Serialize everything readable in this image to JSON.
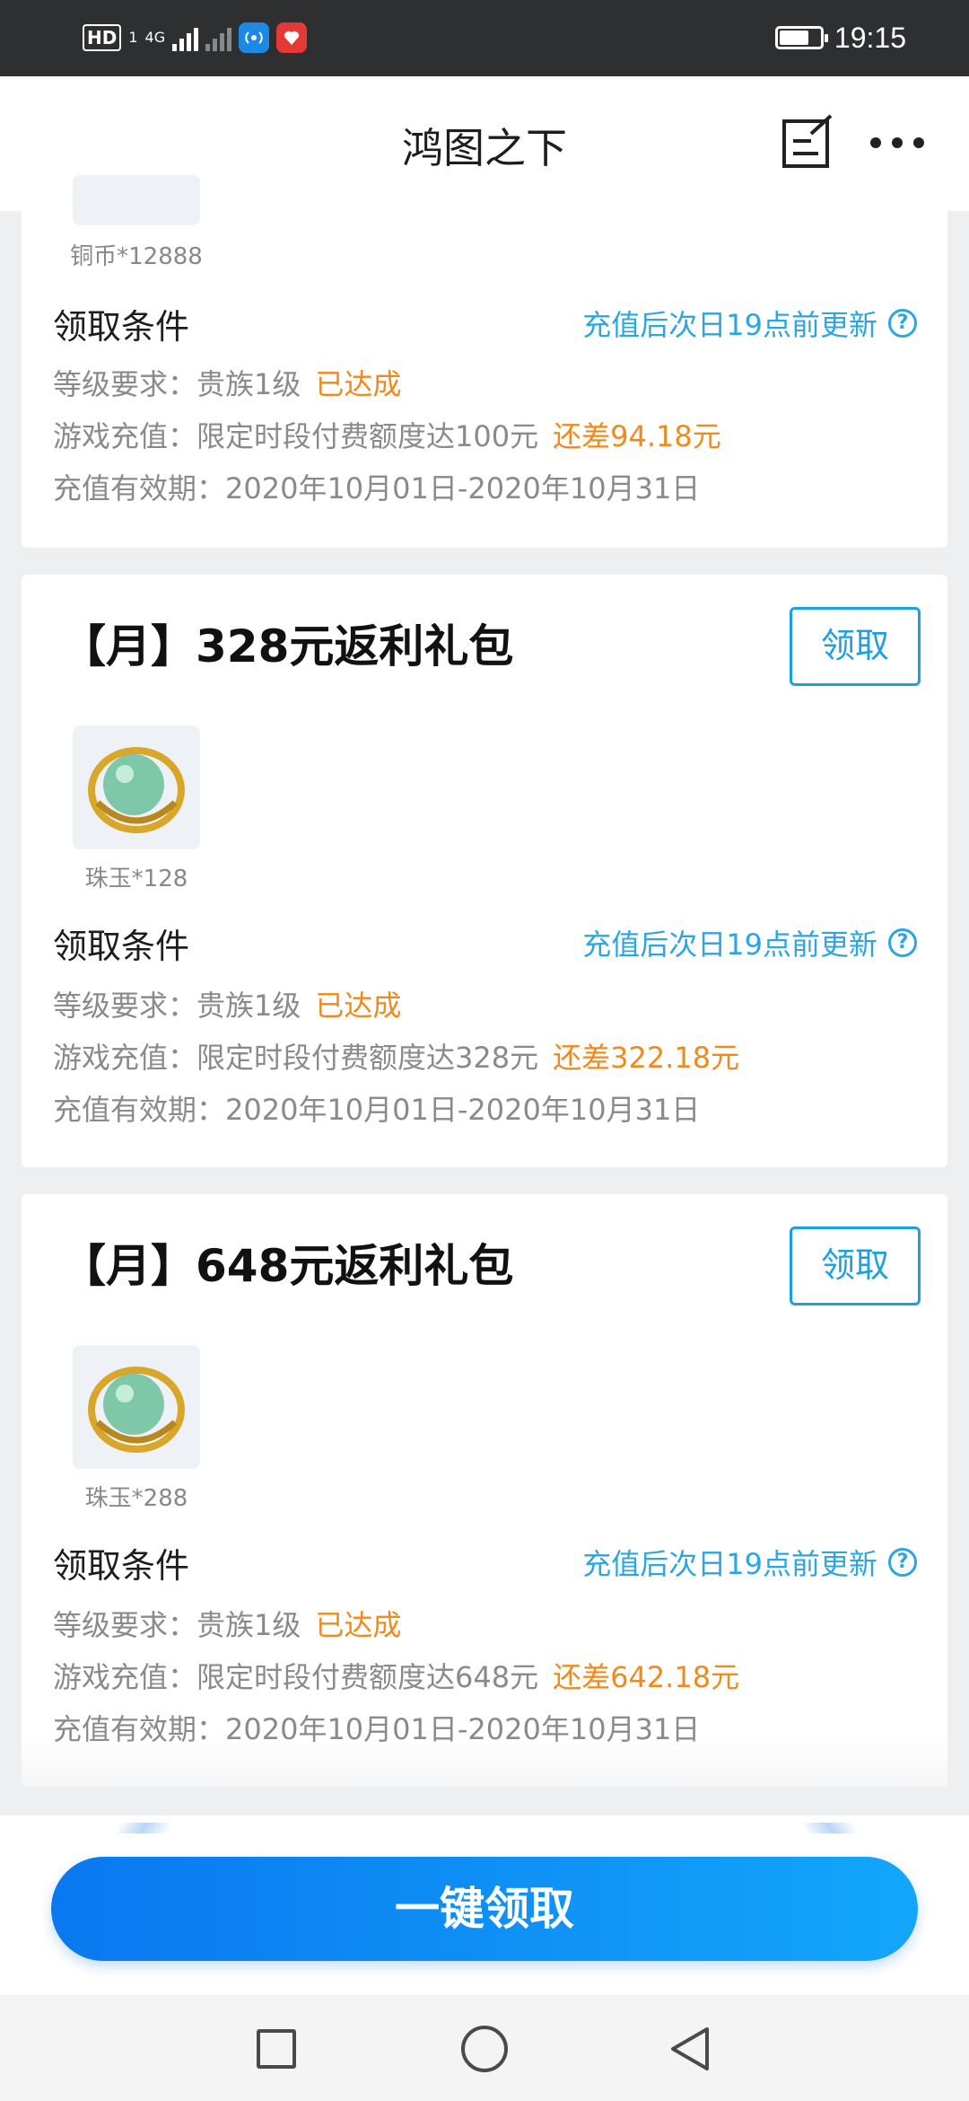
{
  "status_bar": {
    "hd_label": "HD",
    "sim_label": "1",
    "network_label": "4G",
    "time": "19:15"
  },
  "header": {
    "title": "鸿图之下",
    "edit_icon": "edit-note-icon",
    "more_icon": "more-dots-icon"
  },
  "cards": [
    {
      "item": {
        "caption": "铜币*12888"
      },
      "conditions": {
        "title": "领取条件",
        "update_note": "充值后次日19点前更新",
        "level_text": "等级要求：贵族1级",
        "level_status": "已达成",
        "recharge_text": "游戏充值：限定时段付费额度达100元",
        "recharge_diff": "还差94.18元",
        "validity_text": "充值有效期：2020年10月01日-2020年10月31日"
      }
    },
    {
      "title": "【月】328元返利礼包",
      "claim_label": "领取",
      "item": {
        "caption": "珠玉*128"
      },
      "conditions": {
        "title": "领取条件",
        "update_note": "充值后次日19点前更新",
        "level_text": "等级要求：贵族1级",
        "level_status": "已达成",
        "recharge_text": "游戏充值：限定时段付费额度达328元",
        "recharge_diff": "还差322.18元",
        "validity_text": "充值有效期：2020年10月01日-2020年10月31日"
      }
    },
    {
      "title": "【月】648元返利礼包",
      "claim_label": "领取",
      "item": {
        "caption": "珠玉*288"
      },
      "conditions": {
        "title": "领取条件",
        "update_note": "充值后次日19点前更新",
        "level_text": "等级要求：贵族1级",
        "level_status": "已达成",
        "recharge_text": "游戏充值：限定时段付费额度达648元",
        "recharge_diff": "还差642.18元",
        "validity_text": "充值有效期：2020年10月01日-2020年10月31日"
      }
    }
  ],
  "claim_all_label": "一键领取",
  "help_symbol": "?",
  "colors": {
    "accent_blue": "#2aa6e0",
    "status_orange": "#f08a1c",
    "button_gradient_start": "#0a78f0",
    "button_gradient_end": "#13a6fb"
  },
  "nav_bar": {
    "recent_icon": "square-icon",
    "home_icon": "circle-icon",
    "back_icon": "triangle-back-icon"
  }
}
